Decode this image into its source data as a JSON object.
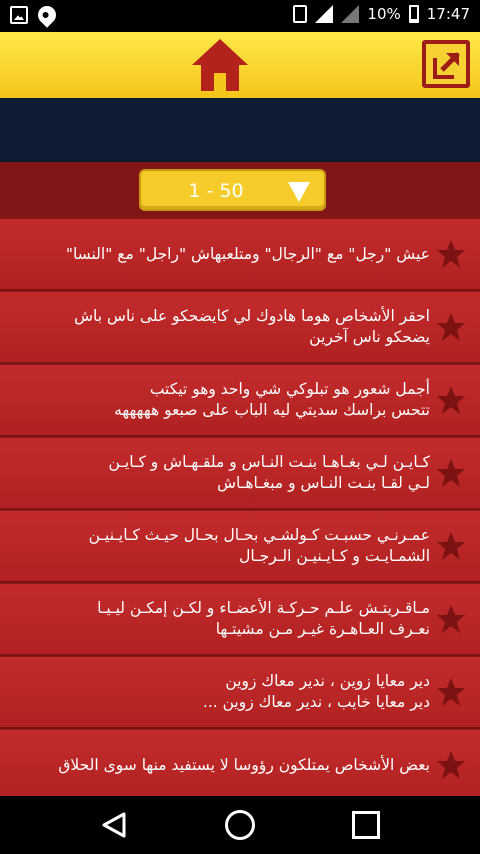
{
  "status_bar": {
    "battery_text": "10%",
    "time": "17:47"
  },
  "header": {
    "home_icon": "home-icon",
    "share_icon": "share-icon"
  },
  "range_select": {
    "value": "1 - 50"
  },
  "list": {
    "items": [
      {
        "lines": [
          "عيش \"رجل\" مع \"الرجال\" ومتلعبهاش \"راجل\" مع \"النسا\""
        ]
      },
      {
        "lines": [
          "احقر الأشخاص هوما هادوك لي كايضحكو على ناس باش",
          "يضحكو ناس آخرين"
        ]
      },
      {
        "lines": [
          "أجمل شعور هو تبلوكي شي واحد وهو تيكتب",
          "تتحس براسك سديتي ليه الباب على صبعو هههههه"
        ]
      },
      {
        "lines": [
          "كـايـن لـي بغـاهـا بنـت النـاس و ملقـهـاش و كـايـن",
          "لـي لقـا بنـت النـاس و مبغـاهـاش"
        ]
      },
      {
        "lines": [
          "عمـرنـي حسبـت كـولشـي بحـال بحـال حيـث كـايـنيـن",
          "الشمـايـت و كـايـنيـن الـرجـال"
        ]
      },
      {
        "lines": [
          "مـاقـريتـش علـم حـركـة الأعضـاء و لكـن إمكـن ليـيـا",
          "نعـرف العـاهـرة غيـر مـن مشيتـها"
        ]
      },
      {
        "lines": [
          "دير معايا زوين ، ندير معاك زوين",
          "دير معايا خايب ، ندير معاك زوين ..."
        ]
      },
      {
        "lines": [
          "بعض الأشخاص يمتلكون رؤوسا لا يستفيد منها سوى الحلاق"
        ]
      }
    ]
  },
  "colors": {
    "header_yellow": "#f4c51a",
    "item_red": "#c32b2b",
    "star_dark": "#7d1212",
    "banner_navy": "#0e1b33"
  }
}
